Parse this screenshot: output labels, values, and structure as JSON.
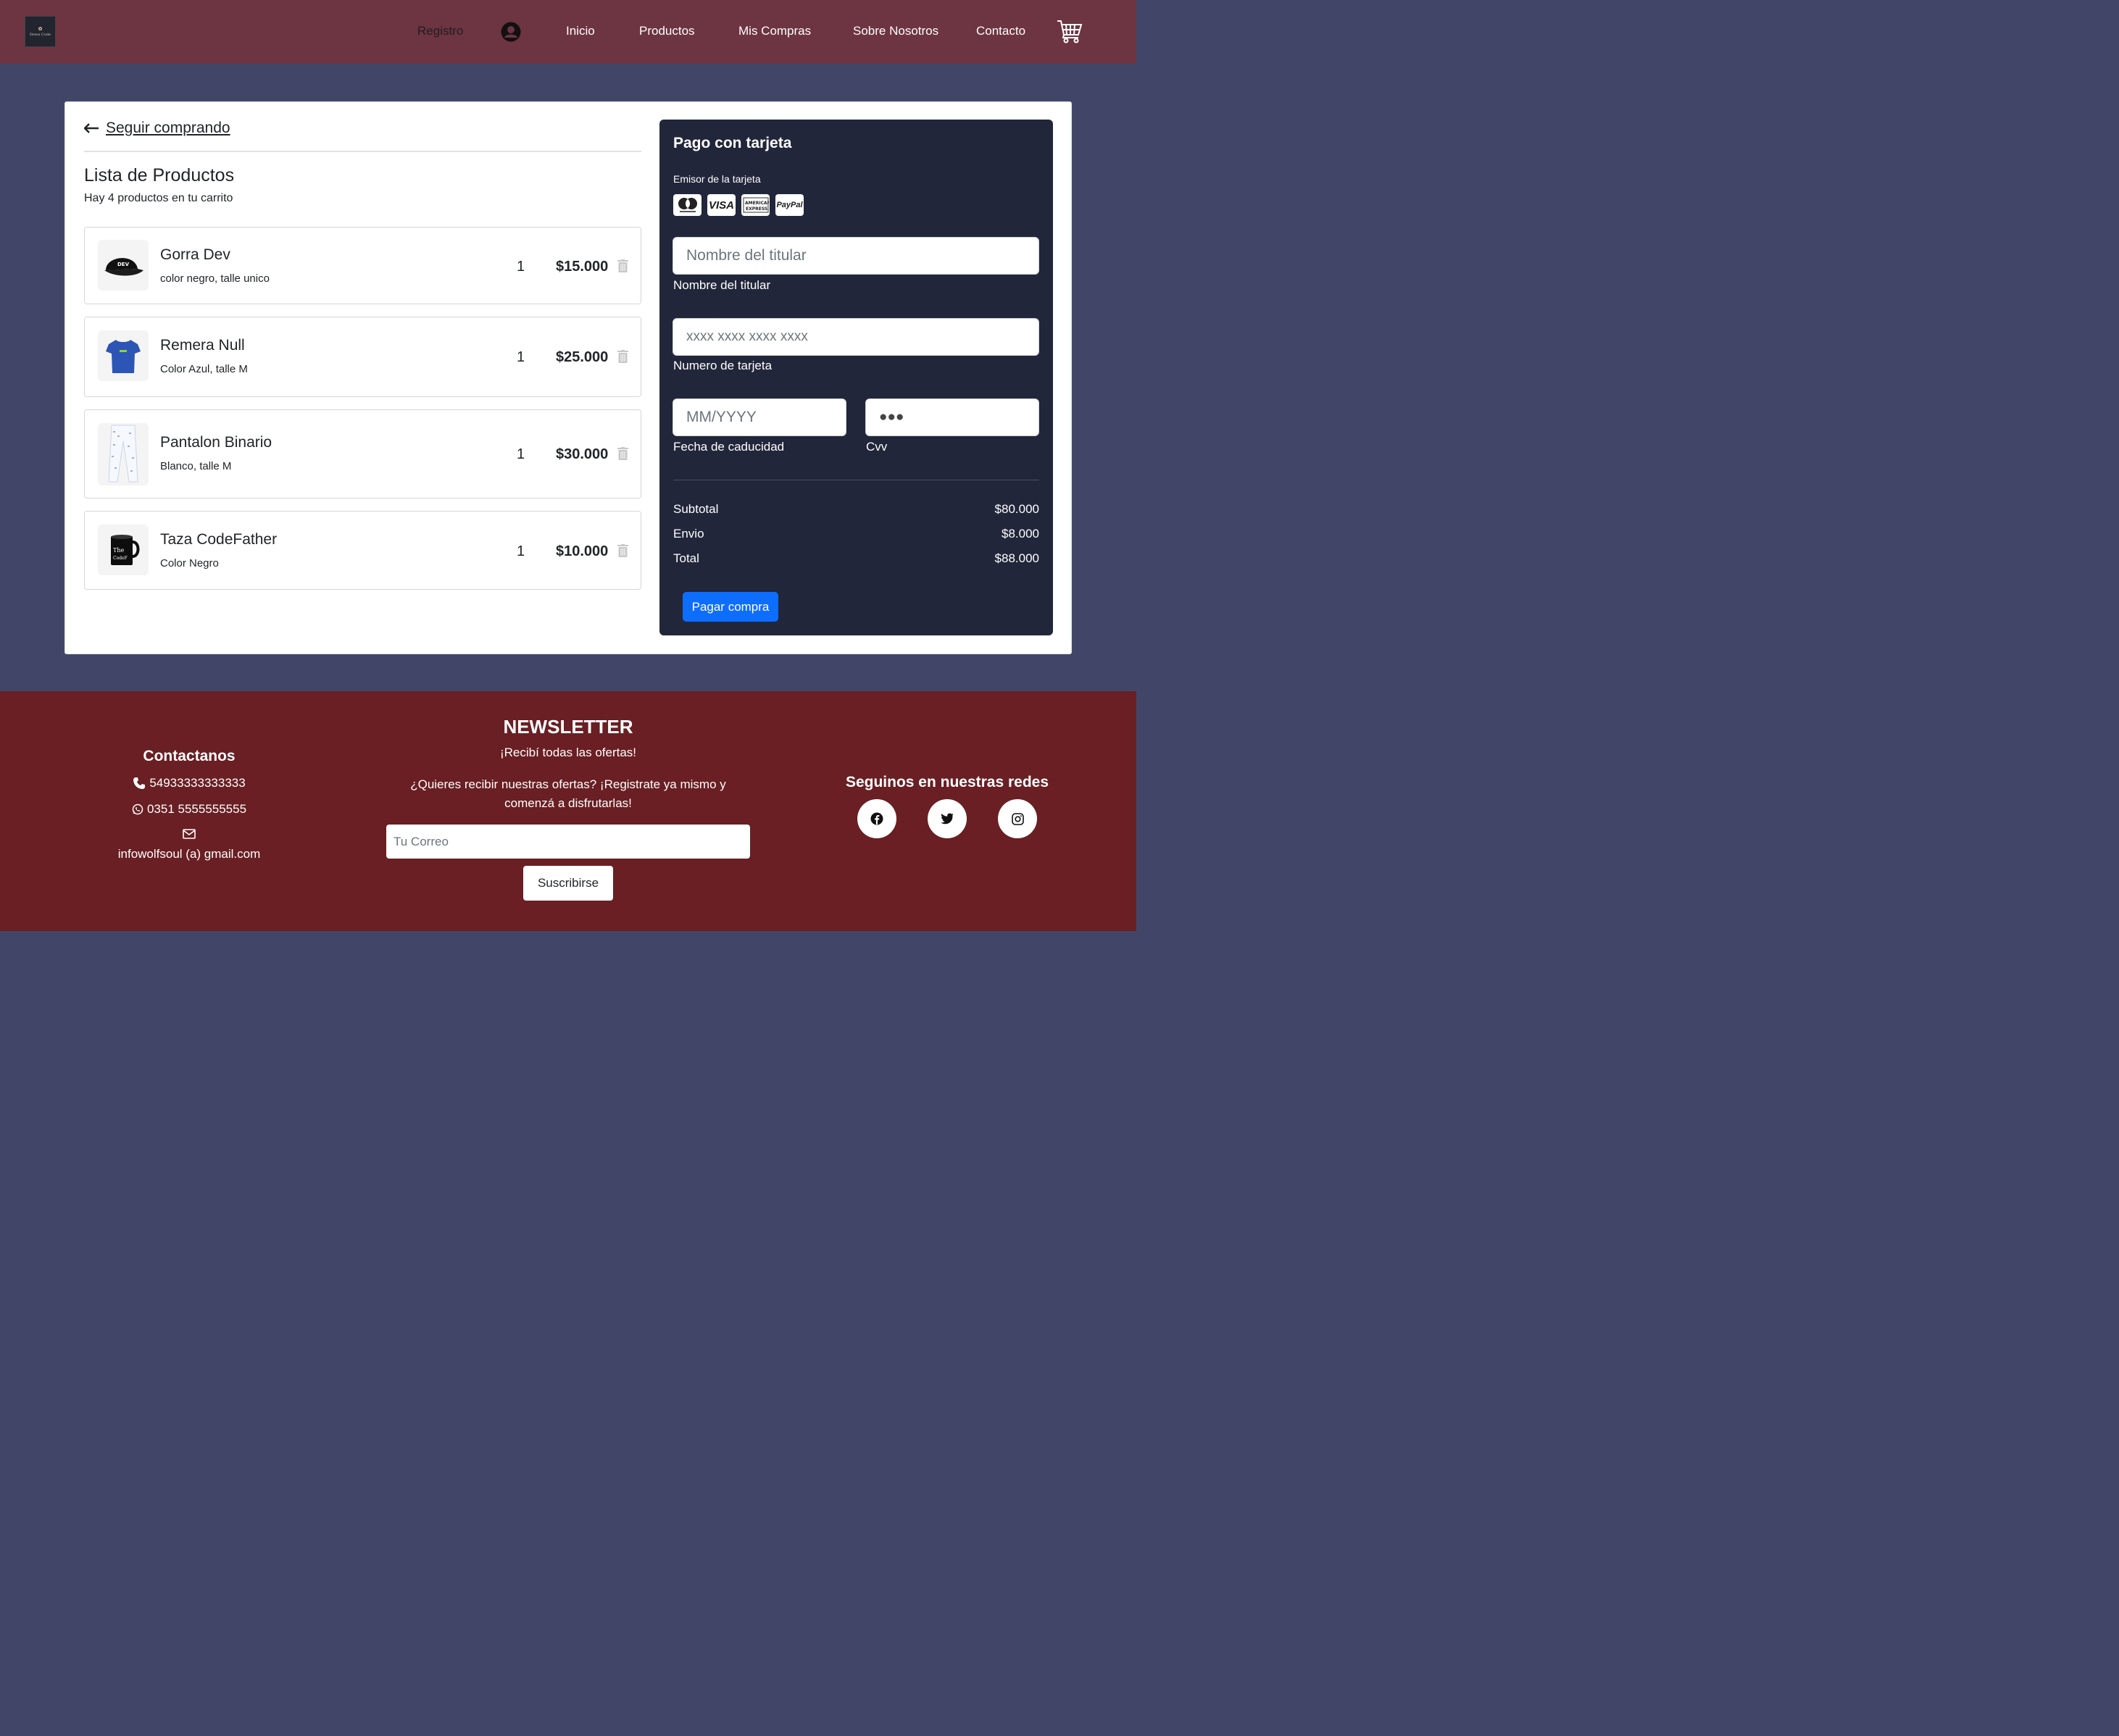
{
  "navbar": {
    "logo_mark": "✿",
    "logo_text": "Dress Code",
    "registro": "Registro",
    "links": [
      "Inicio",
      "Productos",
      "Mis Compras",
      "Sobre Nosotros",
      "Contacto"
    ]
  },
  "cart": {
    "back_label": "Seguir comprando",
    "title": "Lista de Productos",
    "subtitle": "Hay 4 productos en tu carrito",
    "items": [
      {
        "name": "Gorra Dev",
        "desc": "color negro, talle unico",
        "qty": "1",
        "price": "$15.000",
        "image": "cap"
      },
      {
        "name": "Remera Null",
        "desc": "Color Azul, talle M",
        "qty": "1",
        "price": "$25.000",
        "image": "tshirt"
      },
      {
        "name": "Pantalon Binario",
        "desc": "Blanco, talle M",
        "qty": "1",
        "price": "$30.000",
        "image": "pants"
      },
      {
        "name": "Taza CodeFather",
        "desc": "Color Negro",
        "qty": "1",
        "price": "$10.000",
        "image": "mug"
      }
    ]
  },
  "payment": {
    "title": "Pago con tarjeta",
    "issuer_label": "Emisor de la tarjeta",
    "card_brands": [
      "mastercard",
      "VISA",
      "AMERICAN EXPRESS",
      "PayPal"
    ],
    "holder_placeholder": "Nombre del titular",
    "holder_label": "Nombre del titular",
    "number_placeholder": "xxxx xxxx xxxx xxxx",
    "number_label": "Numero de tarjeta",
    "expiry_placeholder": "MM/YYYY",
    "expiry_label": "Fecha de caducidad",
    "cvv_value": "●●●",
    "cvv_label": "Cvv",
    "subtotal_label": "Subtotal",
    "subtotal_value": "$80.000",
    "shipping_label": "Envio",
    "shipping_value": "$8.000",
    "total_label": "Total",
    "total_value": "$88.000",
    "pay_button": "Pagar compra",
    "accent_color": "#0d6efd"
  },
  "footer": {
    "contact_title": "Contactanos",
    "phone": "54933333333333",
    "whatsapp": "0351 5555555555",
    "email": "infowolfsoul (a) gmail.com",
    "newsletter_title": "NEWSLETTER",
    "newsletter_sub": "¡Recibí todas las ofertas!",
    "newsletter_text": "¿Quieres recibir nuestras ofertas? ¡Registrate ya mismo y comenzá a disfrutarlas!",
    "newsletter_placeholder": "Tu Correo",
    "subscribe_button": "Suscribirse",
    "social_title": "Seguinos en nuestras redes",
    "social_icons": [
      "facebook-icon",
      "twitter-icon",
      "instagram-icon"
    ]
  }
}
